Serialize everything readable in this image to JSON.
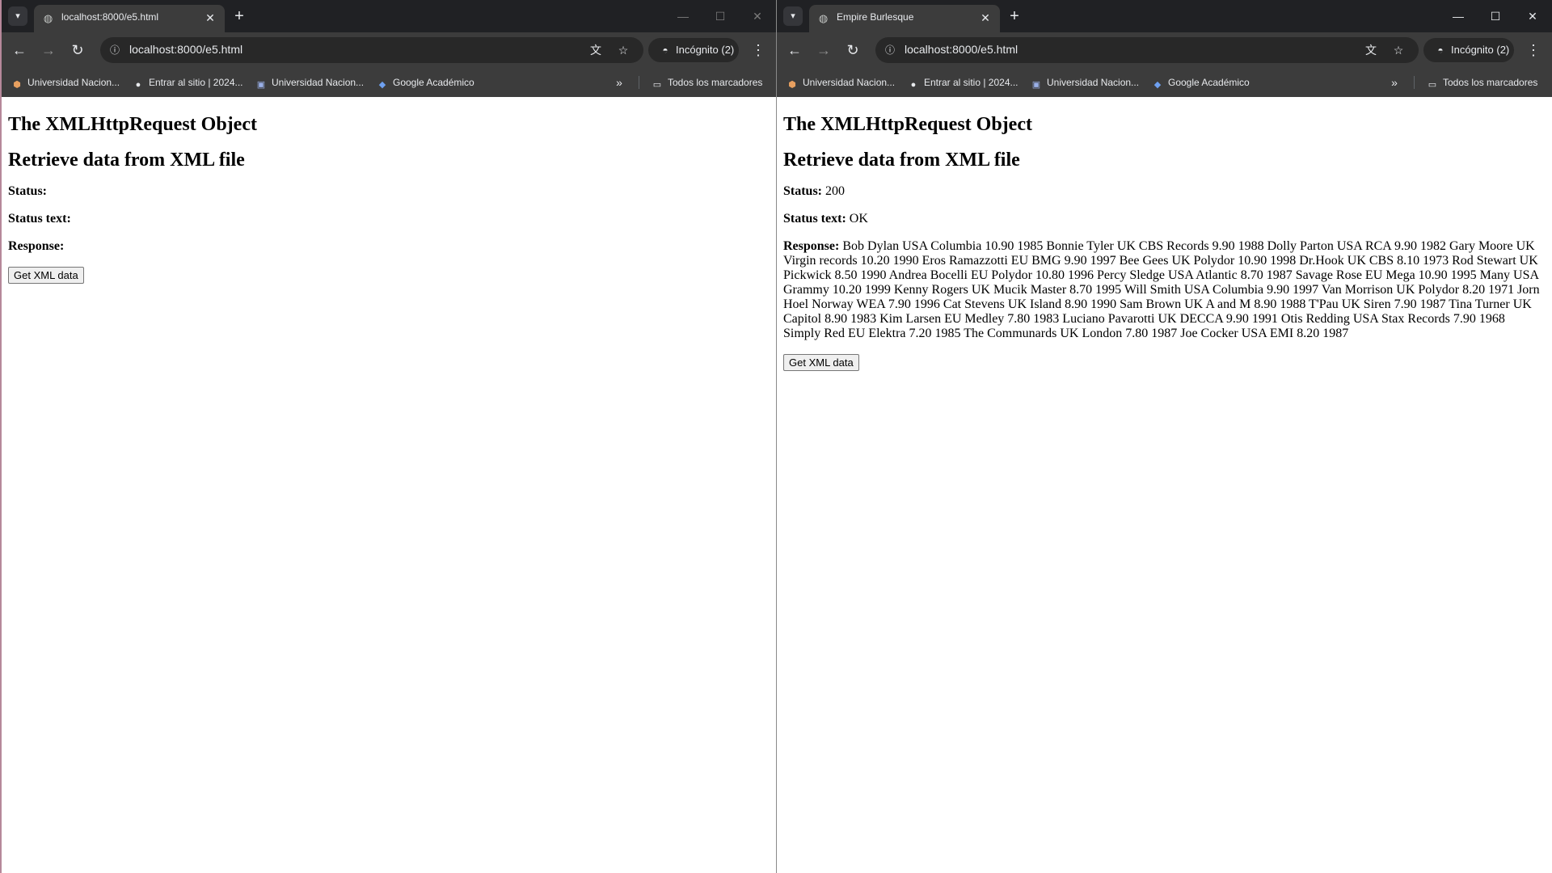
{
  "windows": [
    {
      "tab": {
        "title": "localhost:8000/e5.html",
        "close_glyph": "✕"
      },
      "new_tab_glyph": "+",
      "window_controls": {
        "minimize": "—",
        "maximize": "☐",
        "close": "✕"
      },
      "address": {
        "url": "localhost:8000/e5.html"
      },
      "incognito_label": "Incógnito (2)",
      "bookmarks": [
        {
          "label": "Universidad Nacion...",
          "icon": "university-icon"
        },
        {
          "label": "Entrar al sitio | 2024...",
          "icon": "moodle-icon"
        },
        {
          "label": "Universidad Nacion...",
          "icon": "university-icon"
        },
        {
          "label": "Google Académico",
          "icon": "scholar-icon"
        }
      ],
      "all_bookmarks_label": "Todos los marcadores",
      "page": {
        "heading1": "The XMLHttpRequest Object",
        "heading2": "Retrieve data from XML file",
        "status_label": "Status:",
        "status_value": "",
        "status_text_label": "Status text:",
        "status_text_value": "",
        "response_label": "Response:",
        "response_value": "",
        "button_label": "Get XML data"
      }
    },
    {
      "tab": {
        "title": "Empire Burlesque",
        "close_glyph": "✕"
      },
      "new_tab_glyph": "+",
      "window_controls": {
        "minimize": "—",
        "maximize": "☐",
        "close": "✕"
      },
      "address": {
        "url": "localhost:8000/e5.html"
      },
      "incognito_label": "Incógnito (2)",
      "bookmarks": [
        {
          "label": "Universidad Nacion...",
          "icon": "university-icon"
        },
        {
          "label": "Entrar al sitio | 2024...",
          "icon": "moodle-icon"
        },
        {
          "label": "Universidad Nacion...",
          "icon": "university-icon"
        },
        {
          "label": "Google Académico",
          "icon": "scholar-icon"
        }
      ],
      "all_bookmarks_label": "Todos los marcadores",
      "page": {
        "heading1": "The XMLHttpRequest Object",
        "heading2": "Retrieve data from XML file",
        "status_label": "Status:",
        "status_value": "200",
        "status_text_label": "Status text:",
        "status_text_value": "OK",
        "response_label": "Response:",
        "response_value": "Bob Dylan USA Columbia 10.90 1985 Bonnie Tyler UK CBS Records 9.90 1988 Dolly Parton USA RCA 9.90 1982 Gary Moore UK Virgin records 10.20 1990 Eros Ramazzotti EU BMG 9.90 1997 Bee Gees UK Polydor 10.90 1998 Dr.Hook UK CBS 8.10 1973 Rod Stewart UK Pickwick 8.50 1990 Andrea Bocelli EU Polydor 10.80 1996 Percy Sledge USA Atlantic 8.70 1987 Savage Rose EU Mega 10.90 1995 Many USA Grammy 10.20 1999 Kenny Rogers UK Mucik Master 8.70 1995 Will Smith USA Columbia 9.90 1997 Van Morrison UK Polydor 8.20 1971 Jorn Hoel Norway WEA 7.90 1996 Cat Stevens UK Island 8.90 1990 Sam Brown UK A and M 8.90 1988 T'Pau UK Siren 7.90 1987 Tina Turner UK Capitol 8.90 1983 Kim Larsen EU Medley 7.80 1983 Luciano Pavarotti UK DECCA 9.90 1991 Otis Redding USA Stax Records 7.90 1968 Simply Red EU Elektra 7.20 1985 The Communards UK London 7.80 1987 Joe Cocker USA EMI 8.20 1987",
        "button_label": "Get XML data"
      }
    }
  ]
}
